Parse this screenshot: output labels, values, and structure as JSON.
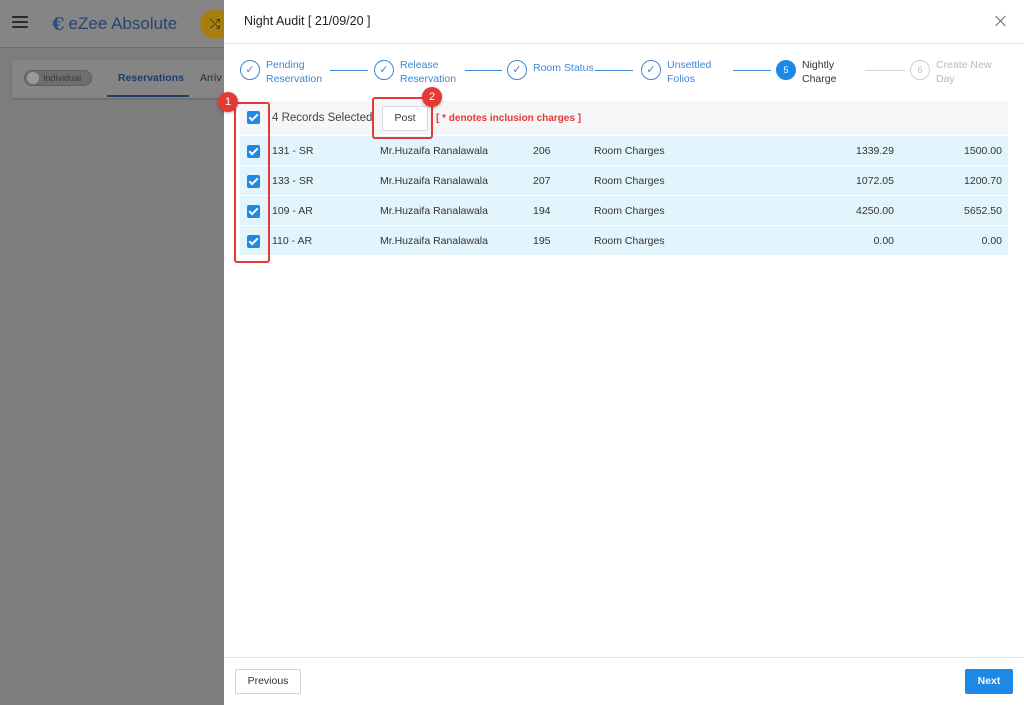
{
  "background": {
    "logo_mark": "€",
    "logo_text": "eZee Absolute",
    "badge_icon": "⤭",
    "toggle_label": "Individual",
    "tab_active": "Reservations",
    "tab_next": "Arriv"
  },
  "modal": {
    "title": "Night Audit [ 21/09/20 ]",
    "steps": [
      {
        "label_line1": "Pending",
        "label_line2": "Reservation",
        "state": "done",
        "icon": "✓"
      },
      {
        "label_line1": "Release",
        "label_line2": "Reservation",
        "state": "done",
        "icon": "✓"
      },
      {
        "label_line1": "Room Status",
        "label_line2": "",
        "state": "done",
        "icon": "✓"
      },
      {
        "label_line1": "Unsettled",
        "label_line2": "Folios",
        "state": "done",
        "icon": "✓"
      },
      {
        "label_line1": "Nightly",
        "label_line2": "Charge",
        "state": "active",
        "icon": "5"
      },
      {
        "label_line1": "Create New",
        "label_line2": "Day",
        "state": "pending",
        "icon": "6"
      }
    ],
    "toolbar": {
      "records_selected": "4 Records Selected",
      "post_label": "Post",
      "inclusion_note": "[ * denotes inclusion charges ]"
    },
    "rows": [
      {
        "room": "131 - SR",
        "guest": "Mr.Huzaifa Ranalawala",
        "res_no": "206",
        "charge_type": "Room Charges",
        "amount": "1339.29",
        "total": "1500.00"
      },
      {
        "room": "133 - SR",
        "guest": "Mr.Huzaifa Ranalawala",
        "res_no": "207",
        "charge_type": "Room Charges",
        "amount": "1072.05",
        "total": "1200.70"
      },
      {
        "room": "109 - AR",
        "guest": "Mr.Huzaifa Ranalawala",
        "res_no": "194",
        "charge_type": "Room Charges",
        "amount": "4250.00",
        "total": "5652.50"
      },
      {
        "room": "110 - AR",
        "guest": "Mr.Huzaifa Ranalawala",
        "res_no": "195",
        "charge_type": "Room Charges",
        "amount": "0.00",
        "total": "0.00"
      }
    ],
    "annotations": [
      "1",
      "2"
    ],
    "footer": {
      "previous_label": "Previous",
      "next_label": "Next"
    }
  },
  "colors": {
    "accent": "#1e88e5",
    "row_bg": "#e3f5fc",
    "annotation_red": "#e53935"
  }
}
